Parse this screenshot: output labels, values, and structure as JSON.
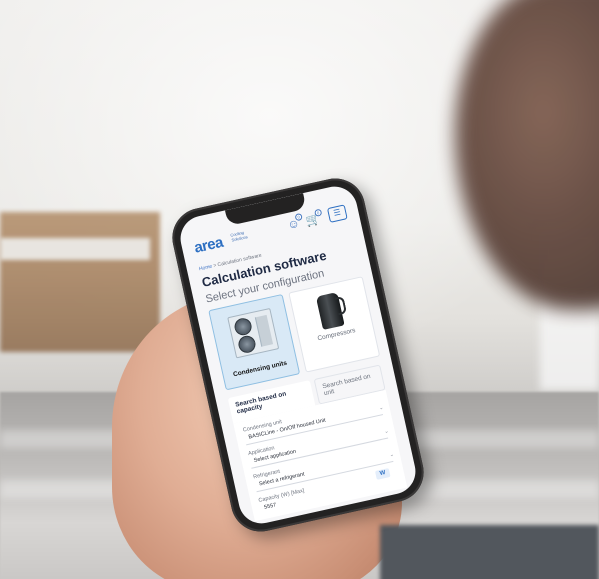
{
  "app": {
    "logo": "area",
    "tagline": "Cooling Solutions",
    "cart_count": "0",
    "user_badge": "0",
    "menu_icon": "menu-icon"
  },
  "breadcrumb": {
    "home": "Home",
    "separator": ">",
    "current": "Calculation software"
  },
  "page": {
    "title": "Calculation software",
    "subtitle": "Select your configuration"
  },
  "cards": [
    {
      "label": "Condensing units",
      "selected": true
    },
    {
      "label": "Compressors",
      "selected": false
    }
  ],
  "tabs": [
    {
      "label": "Search based on capacity",
      "active": true
    },
    {
      "label": "Search based on unit",
      "active": false
    }
  ],
  "form": {
    "condensing_unit": {
      "label": "Condensing unit",
      "value": "BASICLine - On/Off housed Unit"
    },
    "application": {
      "label": "Application",
      "value": "Select application"
    },
    "refrigerant": {
      "label": "Refrigerant",
      "value": "Select a refrigerant"
    },
    "capacity": {
      "label": "Capacity (W) [Max]",
      "value": "5557",
      "unit": "W"
    }
  },
  "colors": {
    "brand": "#2d6fc2",
    "selected_card": "#d9e9f6",
    "title": "#1f2a44"
  }
}
